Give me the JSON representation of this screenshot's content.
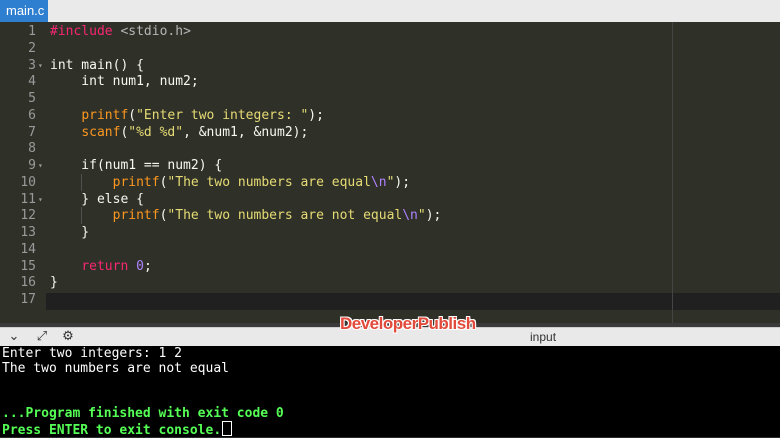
{
  "tab": {
    "label": "main.c"
  },
  "editor": {
    "line_numbers": [
      "1",
      "2",
      "3",
      "4",
      "5",
      "6",
      "7",
      "8",
      "9",
      "10",
      "11",
      "12",
      "13",
      "14",
      "15",
      "16",
      "17"
    ],
    "lines": [
      [
        {
          "t": "#include ",
          "c": "pp"
        },
        {
          "t": "<stdio.h>",
          "c": "hdr"
        }
      ],
      [],
      [
        {
          "t": "int main() {",
          "c": "kw"
        }
      ],
      [
        {
          "t": "    int num1, num2;",
          "c": "kw"
        }
      ],
      [],
      [
        {
          "t": "    ",
          "c": "kw"
        },
        {
          "t": "printf",
          "c": "fn"
        },
        {
          "t": "(",
          "c": "kw"
        },
        {
          "t": "\"Enter two integers: \"",
          "c": "str"
        },
        {
          "t": ");",
          "c": "kw"
        }
      ],
      [
        {
          "t": "    ",
          "c": "kw"
        },
        {
          "t": "scanf",
          "c": "fn"
        },
        {
          "t": "(",
          "c": "kw"
        },
        {
          "t": "\"%d %d\"",
          "c": "str"
        },
        {
          "t": ", &num1, &num2);",
          "c": "kw"
        }
      ],
      [],
      [
        {
          "t": "    if(num1 == num2) {",
          "c": "kw"
        }
      ],
      [
        {
          "t": "        ",
          "c": "kw"
        },
        {
          "t": "printf",
          "c": "fn"
        },
        {
          "t": "(",
          "c": "kw"
        },
        {
          "t": "\"The two numbers are equal",
          "c": "str"
        },
        {
          "t": "\\n",
          "c": "esc"
        },
        {
          "t": "\"",
          "c": "str"
        },
        {
          "t": ");",
          "c": "kw"
        }
      ],
      [
        {
          "t": "    } else {",
          "c": "kw"
        }
      ],
      [
        {
          "t": "        ",
          "c": "kw"
        },
        {
          "t": "printf",
          "c": "fn"
        },
        {
          "t": "(",
          "c": "kw"
        },
        {
          "t": "\"The two numbers are not equal",
          "c": "str"
        },
        {
          "t": "\\n",
          "c": "esc"
        },
        {
          "t": "\"",
          "c": "str"
        },
        {
          "t": ");",
          "c": "kw"
        }
      ],
      [
        {
          "t": "    }",
          "c": "kw"
        }
      ],
      [],
      [
        {
          "t": "    ",
          "c": "kw"
        },
        {
          "t": "return",
          "c": "ret"
        },
        {
          "t": " ",
          "c": "kw"
        },
        {
          "t": "0",
          "c": "num"
        },
        {
          "t": ";",
          "c": "kw"
        }
      ],
      [
        {
          "t": "}",
          "c": "kw"
        }
      ],
      []
    ],
    "fold_lines": [
      3,
      9,
      11
    ]
  },
  "io_bar": {
    "label": "input",
    "watermark": "DeveloperPublish",
    "icons": [
      "chevron-down-icon",
      "expand-icon",
      "settings-icon"
    ]
  },
  "console": {
    "output": [
      "Enter two integers: 1 2",
      "The two numbers are not equal"
    ],
    "finish": [
      "...Program finished with exit code 0",
      "Press ENTER to exit console."
    ]
  },
  "colors": {
    "tab_active": "#2f7fd0",
    "editor_bg": "#2f3129",
    "console_bg": "#000000",
    "finish_text": "#55ff55",
    "watermark": "#e24b3b"
  }
}
